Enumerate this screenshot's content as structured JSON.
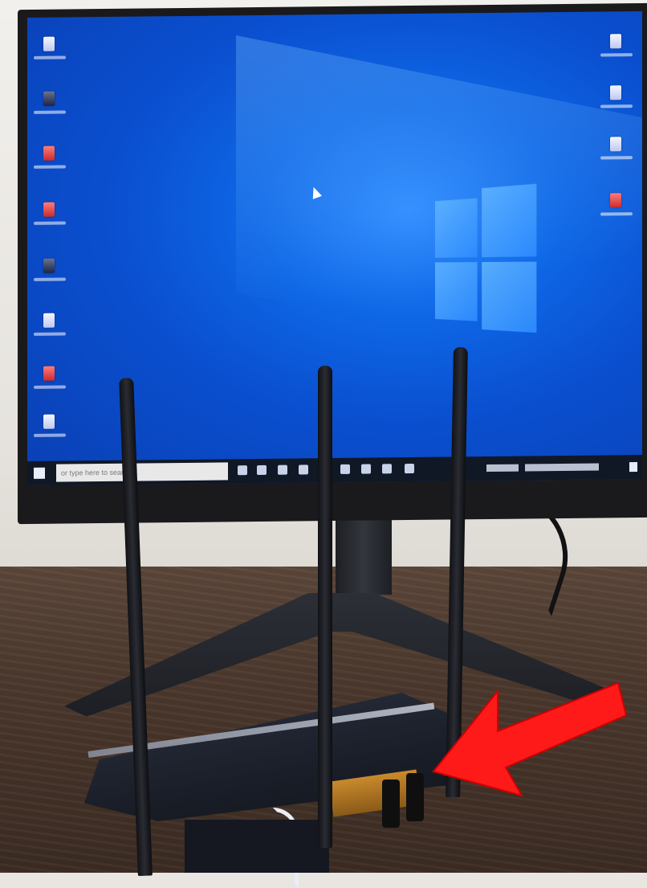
{
  "scene": {
    "colors": {
      "desktop_blue": "#0a4fcf",
      "arrow_red": "#ff1a1a",
      "router_body": "#1a1e28",
      "desk_wood": "#4a372c"
    }
  },
  "taskbar": {
    "search_placeholder": "or type here to search",
    "clock_time": "",
    "clock_date": ""
  },
  "icons": {
    "start": "windows-start-icon",
    "arrow": "red-arrow-pointing-to-router-ports"
  }
}
